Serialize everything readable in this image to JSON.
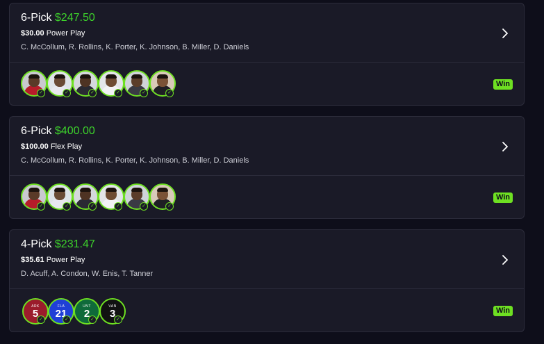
{
  "cards": [
    {
      "pick_label": "6-Pick",
      "payout": "$247.50",
      "entry_amount": "$30.00",
      "play_type": "Power Play",
      "players": "C. McCollum, R. Rollins, K. Porter, K. Johnson, B. Miller, D. Daniels",
      "status": "Win"
    },
    {
      "pick_label": "6-Pick",
      "payout": "$400.00",
      "entry_amount": "$100.00",
      "play_type": "Flex Play",
      "players": "C. McCollum, R. Rollins, K. Porter, K. Johnson, B. Miller, D. Daniels",
      "status": "Win"
    },
    {
      "pick_label": "4-Pick",
      "payout": "$231.47",
      "entry_amount": "$35.61",
      "play_type": "Power Play",
      "players": "D. Acuff, A. Condon, W. Enis, T. Tanner",
      "status": "Win",
      "jerseys": [
        {
          "num": "5",
          "tag": "ARK",
          "color": "#9b1c2c"
        },
        {
          "num": "21",
          "tag": "FLA",
          "color": "#1f3fd6"
        },
        {
          "num": "2",
          "tag": "UNT",
          "color": "#0f6a3a"
        },
        {
          "num": "3",
          "tag": "VAN",
          "color": "#111111"
        }
      ]
    }
  ],
  "colors": {
    "background": "#0e0e1a",
    "card": "#1a1a27",
    "payout_green": "#3dd22b",
    "win_badge": "#6ee022"
  },
  "icons": {
    "chevron": "chevron-right-icon",
    "check": "check-circle-icon"
  }
}
